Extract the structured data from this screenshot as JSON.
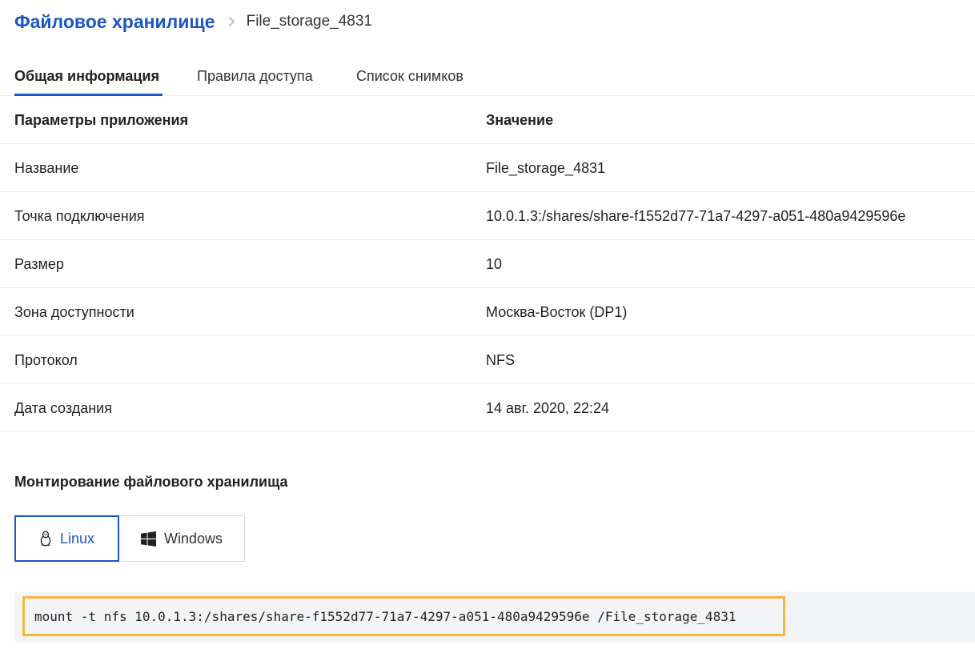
{
  "breadcrumb": {
    "root": "Файловое хранилище",
    "current": "File_storage_4831"
  },
  "tabs": [
    {
      "label": "Общая информация",
      "active": true
    },
    {
      "label": "Правила доступа",
      "active": false
    },
    {
      "label": "Список снимков",
      "active": false
    }
  ],
  "table": {
    "headers": [
      "Параметры приложения",
      "Значение"
    ],
    "rows": [
      [
        "Название",
        "File_storage_4831"
      ],
      [
        "Точка подключения",
        "10.0.1.3:/shares/share-f1552d77-71a7-4297-a051-480a9429596e"
      ],
      [
        "Размер",
        "10"
      ],
      [
        "Зона доступности",
        "Москва-Восток (DP1)"
      ],
      [
        "Протокол",
        "NFS"
      ],
      [
        "Дата создания",
        "14 авг. 2020, 22:24"
      ]
    ]
  },
  "mount": {
    "title": "Монтирование файлового хранилища",
    "os_options": [
      {
        "label": "Linux",
        "icon": "linux-penguin-icon",
        "selected": true
      },
      {
        "label": "Windows",
        "icon": "windows-logo-icon",
        "selected": false
      }
    ],
    "command": "mount -t nfs 10.0.1.3:/shares/share-f1552d77-71a7-4297-a051-480a9429596e /File_storage_4831"
  },
  "colors": {
    "accent": "#1a56c4",
    "highlight_border": "#f5b73b",
    "code_background": "#f3f4f6"
  }
}
